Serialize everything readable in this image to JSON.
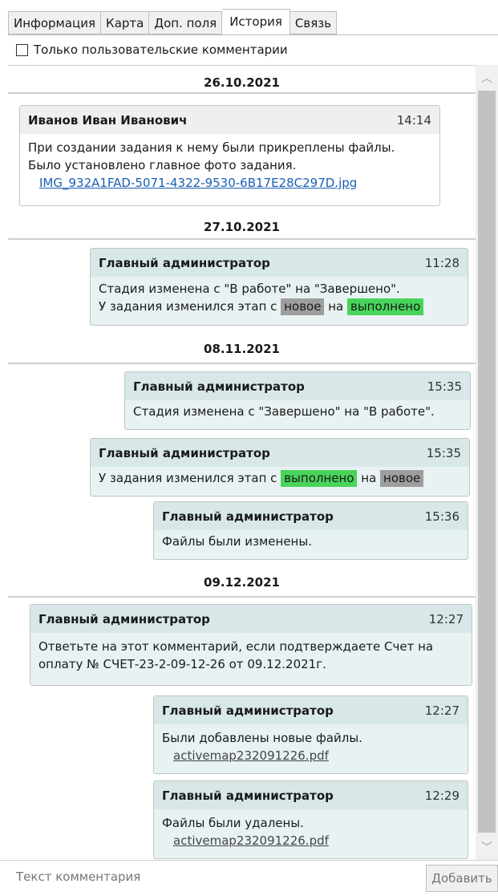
{
  "tabs": [
    "Информация",
    "Карта",
    "Доп. поля",
    "История",
    "Связь"
  ],
  "active_tab": "История",
  "filter": {
    "label": "Только пользовательские комментарии",
    "checked": false
  },
  "dates": [
    "26.10.2021",
    "27.10.2021",
    "08.11.2021",
    "09.12.2021"
  ],
  "messages": [
    {
      "author": "Иванов Иван Иванович",
      "time": "14:14",
      "line1": "При создании задания к нему были прикреплены файлы.",
      "line2": "Было установлено главное фото задания.",
      "link": "IMG_932A1FAD-5071-4322-9530-6B17E28C297D.jpg"
    },
    {
      "author": "Главный администратор",
      "time": "11:28",
      "line1": "Стадия изменена с \"В работе\" на \"Завершено\".",
      "line2_prefix": "У задания изменился этап с",
      "stage_from": "новое",
      "word_on": "на",
      "stage_to": "выполнено"
    },
    {
      "author": "Главный администратор",
      "time": "15:35",
      "line1": "Стадия изменена с \"Завершено\" на \"В работе\"."
    },
    {
      "author": "Главный администратор",
      "time": "15:35",
      "line_prefix": "У задания изменился этап с",
      "stage_from": "выполнено",
      "word_on": "на",
      "stage_to": "новое"
    },
    {
      "author": "Главный администратор",
      "time": "15:36",
      "line1": "Файлы были изменены."
    },
    {
      "author": "Главный администратор",
      "time": "12:27",
      "line1": "Ответьте на этот комментарий, если подтверждаете Счет на",
      "line2": "оплату № СЧЕТ-23-2-09-12-26 от 09.12.2021г."
    },
    {
      "author": "Главный администратор",
      "time": "12:27",
      "line1": "Были добавлены новые файлы.",
      "link": "activemap232091226.pdf"
    },
    {
      "author": "Главный администратор",
      "time": "12:29",
      "line1": "Файлы были удалены.",
      "link": "activemap232091226.pdf"
    }
  ],
  "comment": {
    "placeholder": "Текст комментария",
    "value": ""
  },
  "add_button": "Добавить",
  "colors": {
    "stage_new": "#9e9e9e",
    "stage_done": "#48d45a",
    "system_bubble": "#e8f2f2",
    "system_header": "#d8e8e8"
  },
  "icons": [
    "scroll-up-icon",
    "scroll-down-icon"
  ]
}
